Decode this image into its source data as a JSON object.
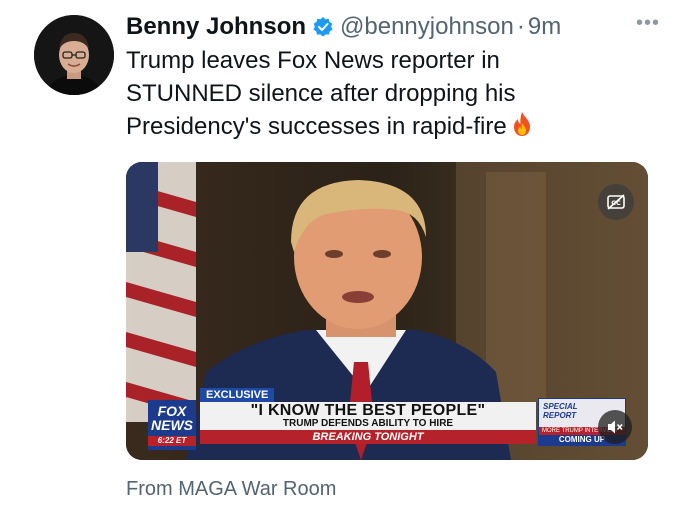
{
  "tweet": {
    "author_name": "Benny Johnson",
    "handle": "@bennyjohnson",
    "separator": "·",
    "time": "9m",
    "more_icon": "more-horizontal-icon",
    "verified_color": "#1d9bf0",
    "text_lines": [
      "Trump leaves Fox News reporter in",
      "STUNNED silence after dropping his",
      "Presidency's successes in rapid-fire"
    ],
    "emoji": "fire-emoji"
  },
  "media": {
    "exclusive_label": "EXCLUSIVE",
    "headline": "\"I KNOW THE BEST PEOPLE\"",
    "subheadline": "TRUMP DEFENDS ABILITY TO HIRE",
    "breaking": "BREAKING TONIGHT",
    "network_logo": [
      "FOX",
      "NEWS",
      "6:22 ET"
    ],
    "special_report": "SPECIAL REPORT",
    "more_trump": "MORE TRUMP INTERVIEW",
    "coming_up": "COMING UP",
    "captions_icon": "closed-captions-off-icon",
    "mute_icon": "volume-muted-icon"
  },
  "attribution": "From MAGA War Room"
}
